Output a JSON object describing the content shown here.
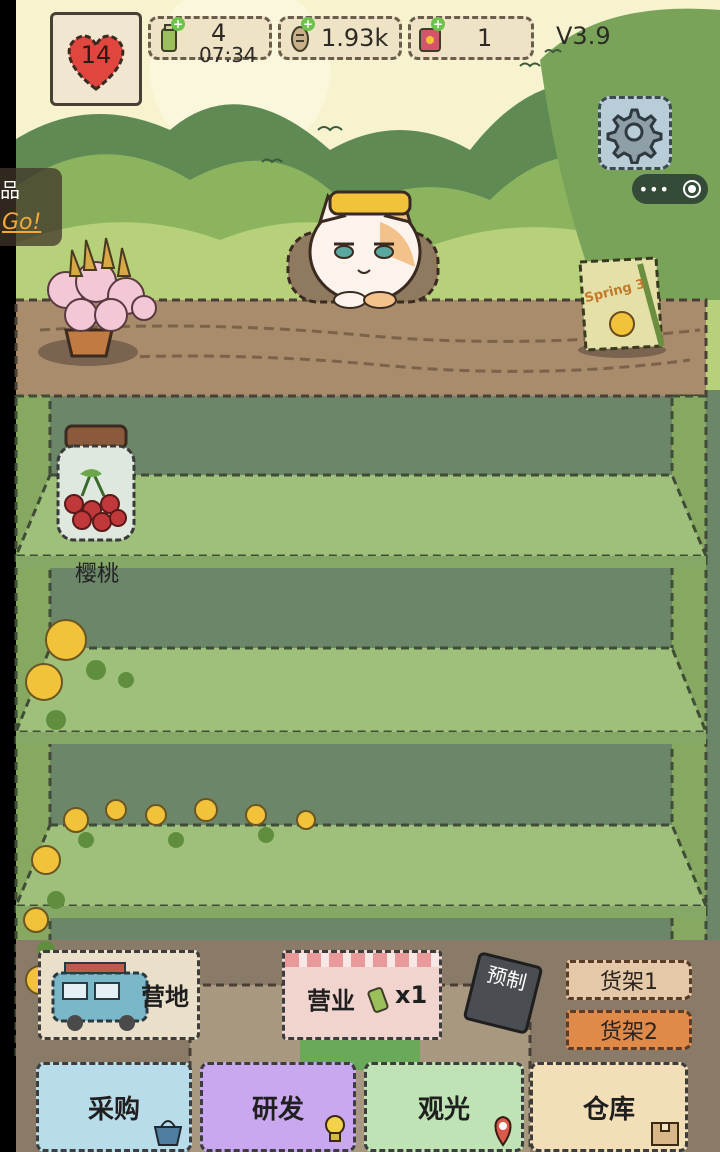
{
  "top_bar": {
    "heart_level": "14",
    "resources": [
      {
        "name": "energy-drink",
        "value": "4",
        "timer": "07:34"
      },
      {
        "name": "fish-coin",
        "value": "1.93k"
      },
      {
        "name": "seed-packet",
        "value": "1"
      }
    ],
    "version": "V3.9"
  },
  "side_tab": {
    "text": "品",
    "link": "Go!"
  },
  "shelf_items": [
    {
      "name": "cherry-jar",
      "label": "樱桃"
    }
  ],
  "calendar_text": "Spring 3",
  "panels": {
    "camp_label": "营地",
    "business_label": "营业",
    "business_count": "x1",
    "preorder_label": "预制"
  },
  "shelf_tabs": [
    "货架1",
    "货架2"
  ],
  "bottom_nav": [
    {
      "label": "采购",
      "color": "#b9dcea",
      "icon": "basket-icon"
    },
    {
      "label": "研发",
      "color": "#c9a8f0",
      "icon": "lightbulb-icon"
    },
    {
      "label": "观光",
      "color": "#bfe3b4",
      "icon": "map-pin-icon"
    },
    {
      "label": "仓库",
      "color": "#f2dfb8",
      "icon": "box-icon"
    }
  ],
  "colors": {
    "sky": "#f7f3cf",
    "hills": "#8cb45f",
    "wall": "#6b8668",
    "shelf_board": "#9fc07a",
    "counter": "#a88c6b"
  }
}
